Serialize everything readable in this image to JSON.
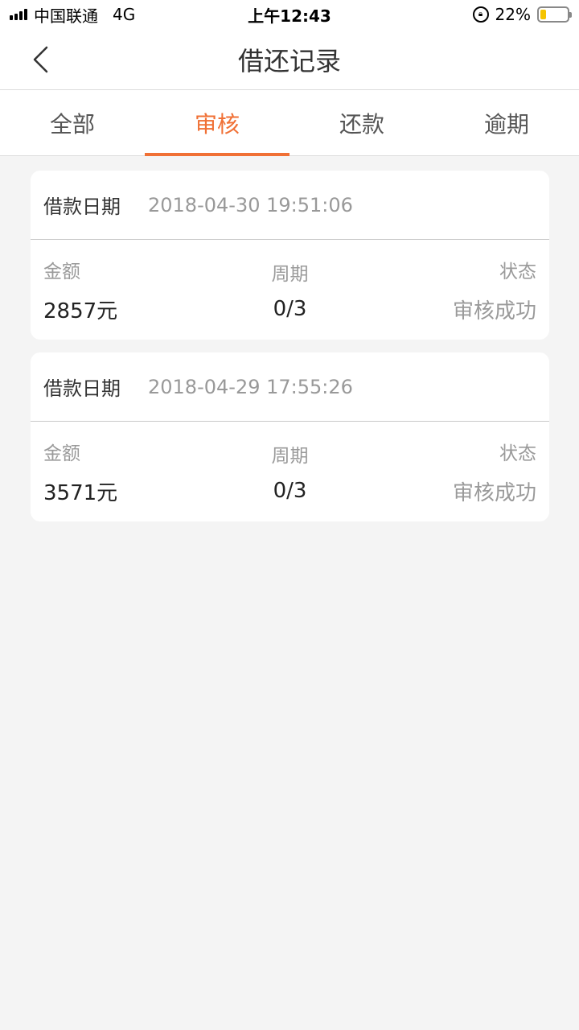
{
  "status_bar": {
    "carrier": "中国联通",
    "network": "4G",
    "time": "上午12:43",
    "battery_percent": "22%",
    "battery_level": 0.22,
    "battery_color": "#f5c400"
  },
  "nav": {
    "title": "借还记录",
    "back_icon": "chevron-left-icon"
  },
  "tabs": [
    {
      "label": "全部",
      "active": false
    },
    {
      "label": "审核",
      "active": true
    },
    {
      "label": "还款",
      "active": false
    },
    {
      "label": "逾期",
      "active": false
    }
  ],
  "accent_color": "#f07035",
  "records": [
    {
      "date_label": "借款日期",
      "date": "2018-04-30 19:51:06",
      "amount_label": "金额",
      "amount": "2857元",
      "period_label": "周期",
      "period": "0/3",
      "status_label": "状态",
      "status": "审核成功"
    },
    {
      "date_label": "借款日期",
      "date": "2018-04-29 17:55:26",
      "amount_label": "金额",
      "amount": "3571元",
      "period_label": "周期",
      "period": "0/3",
      "status_label": "状态",
      "status": "审核成功"
    }
  ]
}
